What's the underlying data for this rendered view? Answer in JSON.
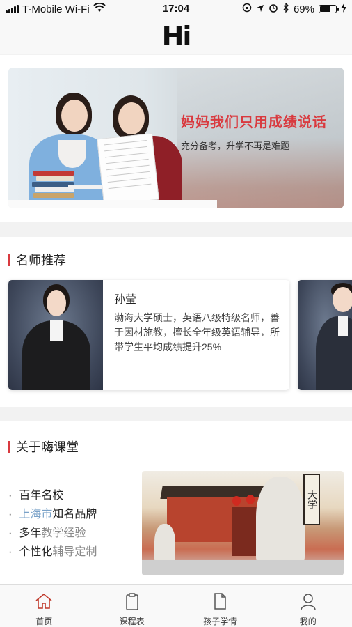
{
  "status_bar": {
    "carrier": "T-Mobile Wi-Fi",
    "time": "17:04",
    "battery": "69%",
    "battery_level": 0.69
  },
  "nav": {
    "logo": "Hi"
  },
  "banner": {
    "title": "妈妈我们只用成绩说话",
    "subtitle": "充分备考，升学不再是难题"
  },
  "teachers": {
    "heading": "名师推荐",
    "items": [
      {
        "name": "孙莹",
        "desc": "渤海大学硕士，英语八级特级名师，善于因材施教，擅长全年级英语辅导，所带学生平均成绩提升25%"
      }
    ]
  },
  "about": {
    "heading": "关于嗨课堂",
    "points": [
      {
        "parts": [
          "百年名校"
        ]
      },
      {
        "parts": [
          "上海市",
          "知名品牌"
        ]
      },
      {
        "parts": [
          "多年",
          "教学经验"
        ]
      },
      {
        "parts": [
          "个性化",
          "辅导定制"
        ]
      }
    ],
    "plaque_text": "大学"
  },
  "tabs": [
    {
      "label": "首页",
      "icon": "home-icon",
      "active": true
    },
    {
      "label": "课程表",
      "icon": "clipboard-icon",
      "active": false
    },
    {
      "label": "孩子学情",
      "icon": "document-icon",
      "active": false
    },
    {
      "label": "我的",
      "icon": "user-icon",
      "active": false
    }
  ],
  "colors": {
    "accent": "#d93a3f",
    "muted_blue": "#7aa2c8",
    "muted_gray": "#8a8a8a"
  }
}
